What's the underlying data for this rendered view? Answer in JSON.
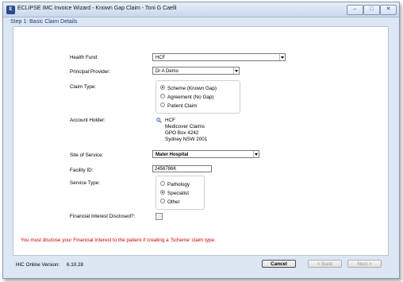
{
  "window": {
    "icon_text": "E",
    "title": "ECLIPSE IMC Invoice Wizard - Known Gap Claim - Toni G Caelli",
    "minimize_glyph": "–",
    "maximize_glyph": "□",
    "close_glyph": "✕"
  },
  "step_title": "Step 1: Basic Claim Details",
  "form": {
    "health_fund_label": "Health Fund:",
    "health_fund_value": "HCF",
    "principal_provider_label": "Principal Provider:",
    "principal_provider_value": "Dr A Demo",
    "claim_type_label": "Claim Type:",
    "claim_type_options": [
      {
        "label": "Scheme (Known Gap)",
        "selected": true
      },
      {
        "label": "Agreement (No Gap)",
        "selected": false
      },
      {
        "label": "Patient Claim",
        "selected": false
      }
    ],
    "account_holder_label": "Account Holder:",
    "account_holder_lines": [
      "HCF",
      "Medicover Claims",
      "GPO Box 4242",
      "Sydney NSW 2001"
    ],
    "site_of_service_label": "Site of Service:",
    "site_of_service_value": "Mater Hospital",
    "facility_id_label": "Facility ID:",
    "facility_id_value": "2456786K",
    "service_type_label": "Service Type:",
    "service_type_options": [
      {
        "label": "Pathology",
        "selected": false
      },
      {
        "label": "Specialist",
        "selected": true
      },
      {
        "label": "Other",
        "selected": false
      }
    ],
    "financial_interest_label": "Financial Interest Disclosed?:",
    "financial_interest_checked": false
  },
  "warning_text": "You must disclose your Financial Interest to the patient if creating a 'Scheme' claim type.",
  "footer": {
    "version_label": "HIC Online Version:",
    "version_value": "6.10.28",
    "cancel_label": "Cancel",
    "back_label": "< Back",
    "next_label": "Next >"
  },
  "icons": {
    "app": "eclipse-app-icon",
    "lookup": "magnifier-icon"
  },
  "colors": {
    "window_bg": "#dde6f3",
    "step_title": "#203e74",
    "warning": "#cc0000"
  }
}
